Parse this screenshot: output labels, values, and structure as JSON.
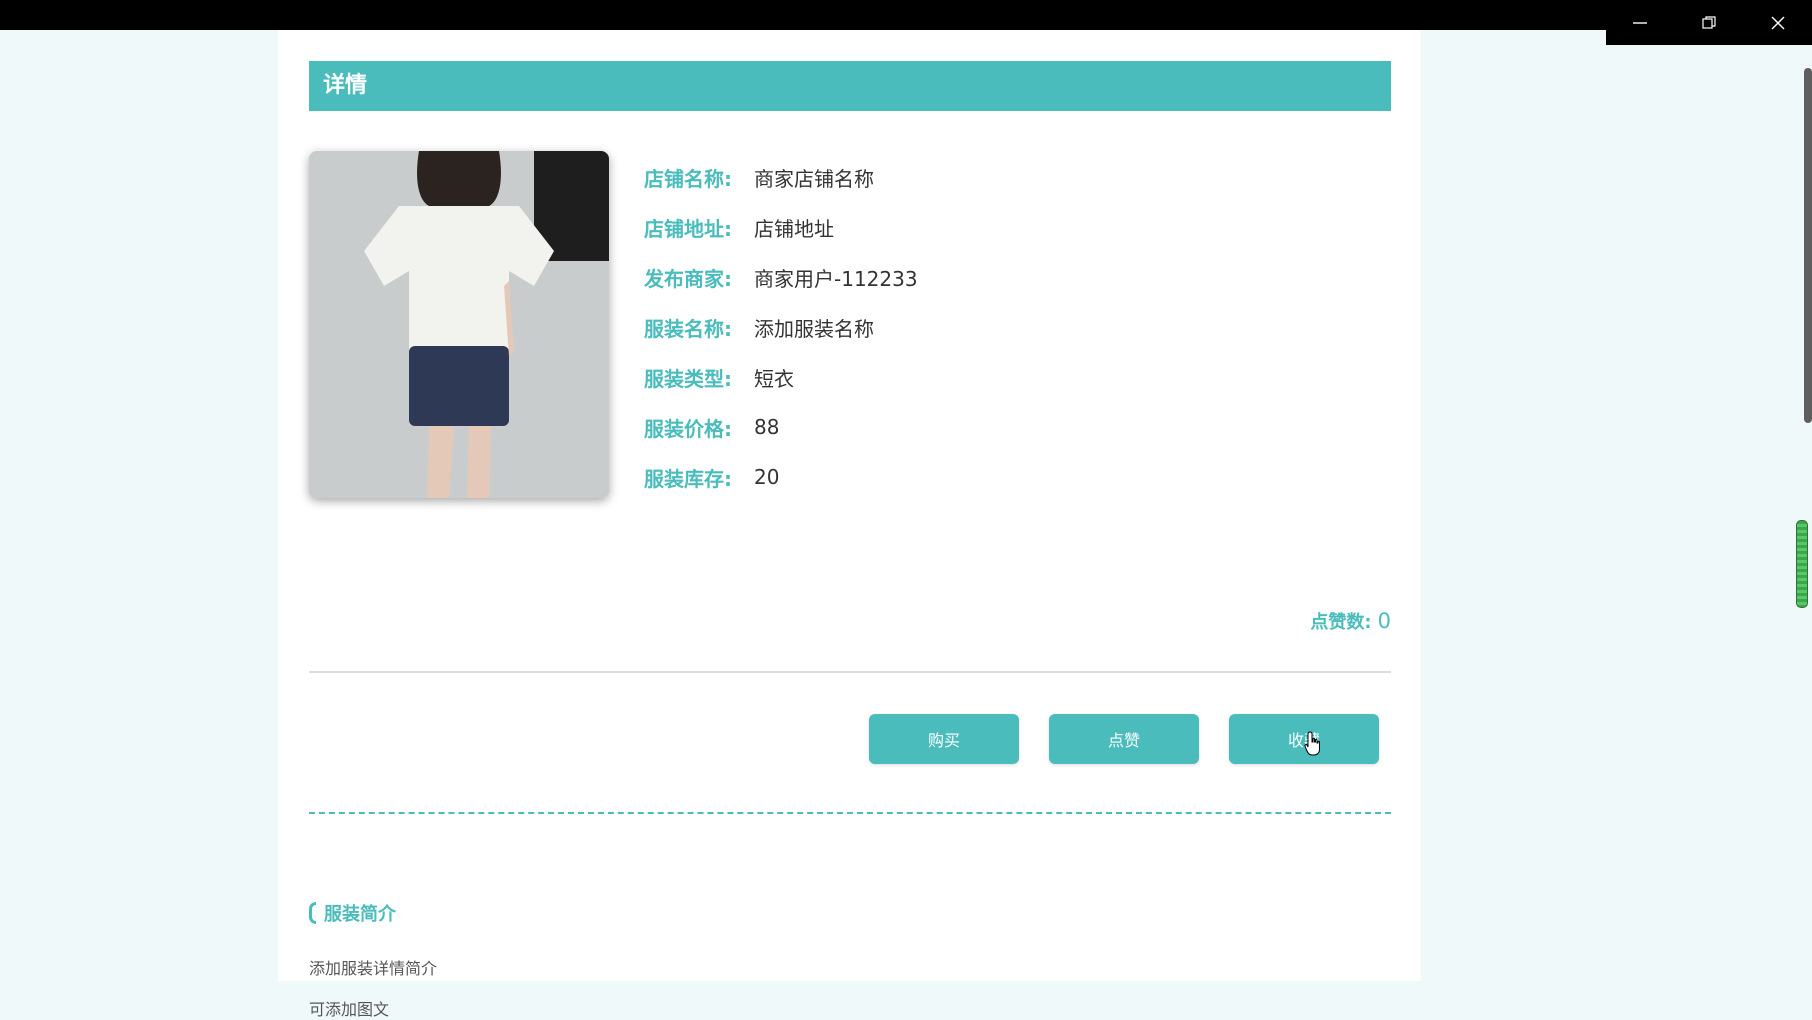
{
  "window": {
    "minimize_icon": "minimize-icon",
    "restore_icon": "restore-icon",
    "close_icon": "close-icon"
  },
  "page": {
    "header": "详情",
    "product_image_icon": "product-photo",
    "info": [
      {
        "label": "店铺名称:",
        "value": "商家店铺名称"
      },
      {
        "label": "店铺地址:",
        "value": "店铺地址"
      },
      {
        "label": "发布商家:",
        "value": "商家用户-112233"
      },
      {
        "label": "服装名称:",
        "value": "添加服装名称"
      },
      {
        "label": "服装类型:",
        "value": "短衣"
      },
      {
        "label": "服装价格:",
        "value": "88"
      },
      {
        "label": "服装库存:",
        "value": "20"
      }
    ],
    "likes": {
      "label": "点赞数:",
      "value": "0"
    },
    "buttons": {
      "buy": "购买",
      "like": "点赞",
      "favorite": "收藏"
    },
    "section": {
      "title": "服装简介",
      "desc_line1": "添加服装详情简介",
      "desc_line2": "可添加图文"
    }
  },
  "colors": {
    "accent": "#4abcbc",
    "title_bar": "#000000",
    "background": "#f0f9f9"
  }
}
